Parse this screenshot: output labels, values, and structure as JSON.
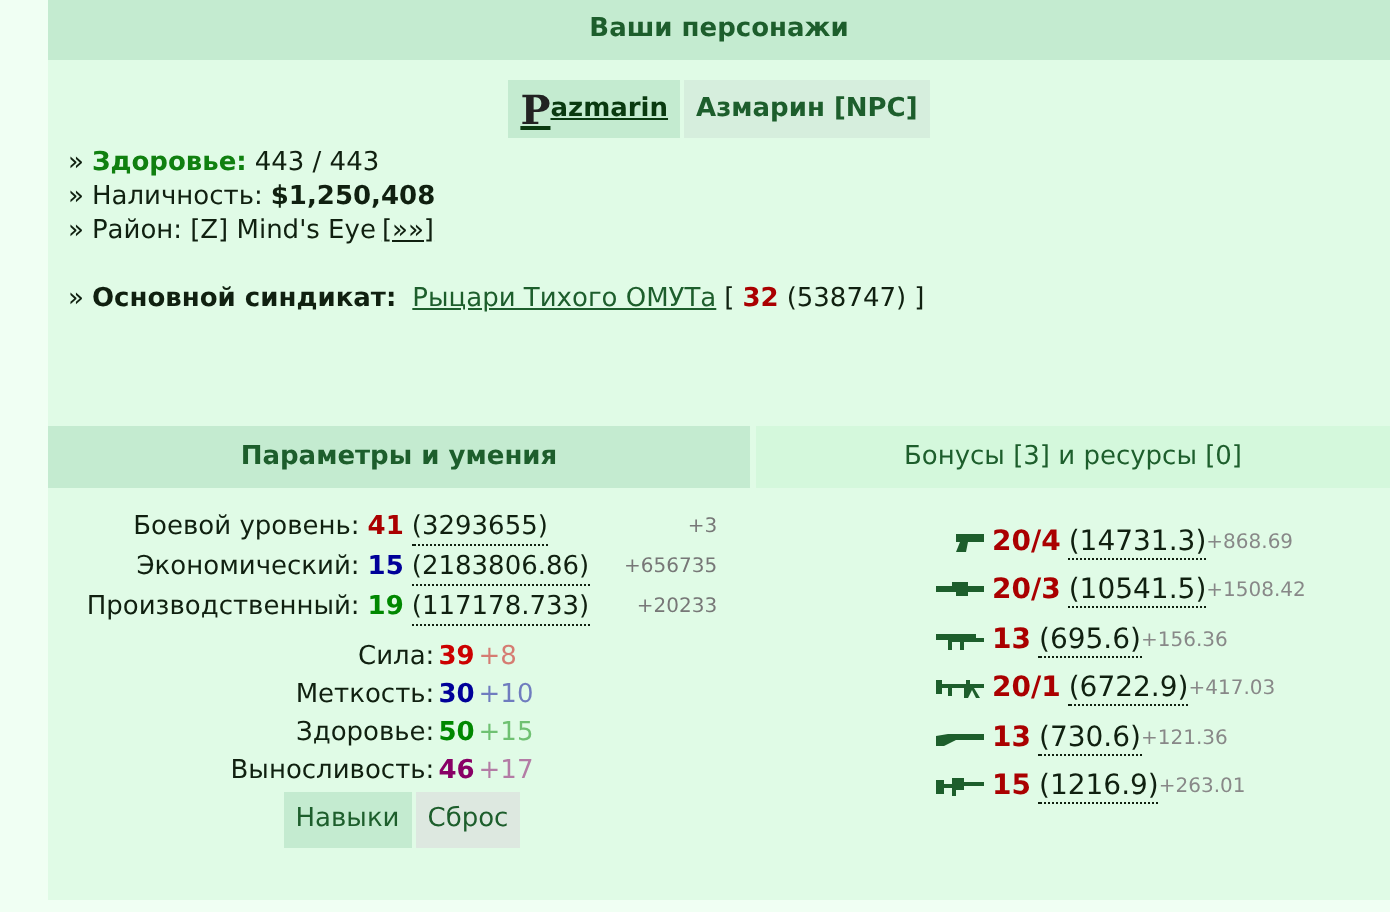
{
  "header": {
    "title": "Ваши персонажи"
  },
  "characters": [
    {
      "name": "azmarin",
      "avatar": "P",
      "selected": true
    },
    {
      "name": "Азмарин [NPC]",
      "selected": false
    }
  ],
  "info": {
    "health_label": "Здоровье:",
    "health": "443 / 443",
    "cash_label": "Наличность:",
    "cash": "$1,250,408",
    "district_label": "Район:",
    "district": "[Z] Mind's Eye",
    "district_link": "[»»]",
    "syndicate_label": "Основной синдикат:",
    "syndicate": "Рыцари Тихого ОМУТа",
    "syndicate_open": "[",
    "syndicate_close": "]",
    "syndicate_level": "32",
    "syndicate_points": "(538747)",
    "bullet": "»"
  },
  "tabs": [
    {
      "label": "Параметры и умения",
      "selected": true
    },
    {
      "label": "Бонусы [3] и ресурсы [0]",
      "selected": false
    }
  ],
  "levels": [
    {
      "label": "Боевой уровень:",
      "value": "41",
      "exp": "(3293655)",
      "gain": "+3",
      "color": "#aa0000"
    },
    {
      "label": "Экономический:",
      "value": "15",
      "exp": "(2183806.86)",
      "gain": "+656735",
      "color": "#000099"
    },
    {
      "label": "Производственный:",
      "value": "19",
      "exp": "(117178.733)",
      "gain": "+20233",
      "color": "#008800"
    }
  ],
  "stats": [
    {
      "label": "Сила:",
      "value": "39",
      "bonus": "+8",
      "color": "#cc0000"
    },
    {
      "label": "Меткость:",
      "value": "30",
      "bonus": "+10",
      "color": "#000099"
    },
    {
      "label": "Здоровье:",
      "value": "50",
      "bonus": "+15",
      "color": "#008800"
    },
    {
      "label": "Выносливость:",
      "value": "46",
      "bonus": "+17",
      "color": "#880066"
    }
  ],
  "buttons": [
    {
      "label": "Навыки",
      "selected": true
    },
    {
      "label": "Сброс",
      "selected": false
    }
  ],
  "weapons": [
    {
      "kind": "pistol",
      "level": "20/4",
      "exp": "(14731.3)",
      "gain": "+868.69"
    },
    {
      "kind": "launcher",
      "level": "20/3",
      "exp": "(10541.5)",
      "gain": "+1508.42"
    },
    {
      "kind": "smg",
      "level": "13",
      "exp": "(695.6)",
      "gain": "+156.36"
    },
    {
      "kind": "machinegun",
      "level": "20/1",
      "exp": "(6722.9)",
      "gain": "+417.03"
    },
    {
      "kind": "shotgun",
      "level": "13",
      "exp": "(730.6)",
      "gain": "+121.36"
    },
    {
      "kind": "rifle",
      "level": "15",
      "exp": "(1216.9)",
      "gain": "+263.01"
    }
  ]
}
